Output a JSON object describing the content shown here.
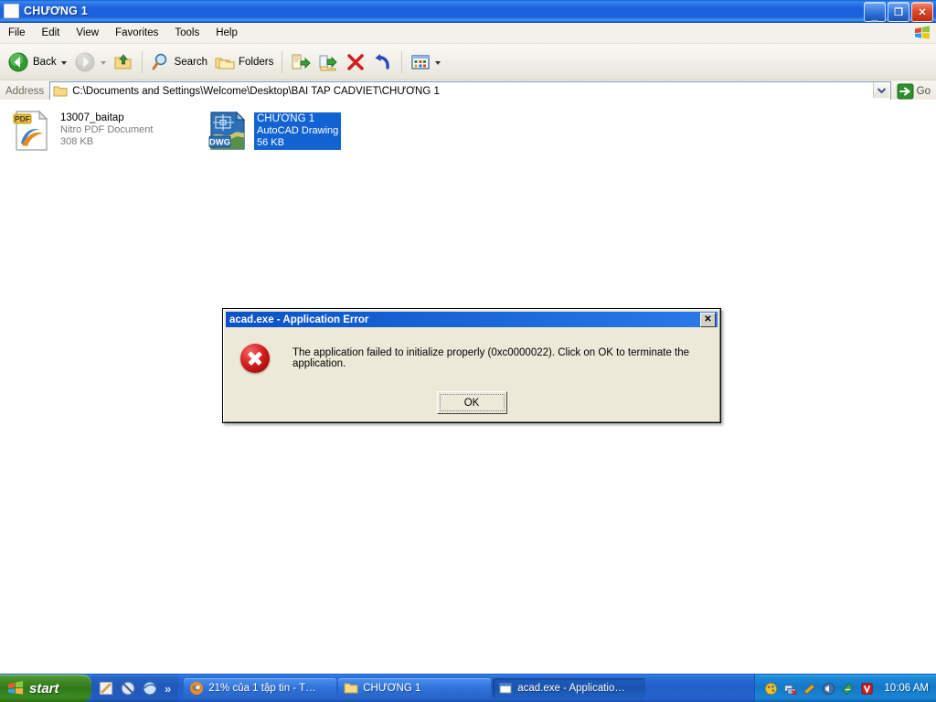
{
  "window": {
    "title": "CHƯƠNG 1",
    "icon": "folder-window-icon",
    "buttons": {
      "minimize": "_",
      "maximize": "❐",
      "close": "✕"
    }
  },
  "menu": {
    "items": [
      {
        "label": "File"
      },
      {
        "label": "Edit"
      },
      {
        "label": "View"
      },
      {
        "label": "Favorites"
      },
      {
        "label": "Tools"
      },
      {
        "label": "Help"
      }
    ],
    "logo": "windows-flag-logo"
  },
  "toolbar": {
    "back": "Back",
    "forward": "",
    "up": "",
    "search": "Search",
    "folders": "Folders",
    "move_to": "",
    "copy_to": "",
    "delete": "",
    "undo": "",
    "views": ""
  },
  "address": {
    "label": "Address",
    "path": "C:\\Documents and Settings\\Welcome\\Desktop\\BAI TAP CADVIET\\CHƯƠNG 1",
    "go_label": "Go"
  },
  "files": [
    {
      "name": "13007_baitap",
      "type": "Nitro PDF Document",
      "size": "308 KB",
      "icon": "pdf-file-icon",
      "badge": "PDF",
      "selected": false
    },
    {
      "name": "CHƯƠNG 1",
      "type": "AutoCAD Drawing",
      "size": "56 KB",
      "icon": "dwg-file-icon",
      "badge": "DWG",
      "selected": true
    }
  ],
  "dialog": {
    "title": "acad.exe - Application Error",
    "close_glyph": "✕",
    "icon": "error-circle-icon",
    "message": "The application failed to initialize properly (0xc0000022). Click on OK to terminate the application.",
    "ok_label": "OK"
  },
  "taskbar": {
    "start_label": "start",
    "quicklaunch_overflow": "»",
    "tasks": [
      {
        "label": "21% của 1 tập tin - T…",
        "icon": "firefox-icon",
        "active": false
      },
      {
        "label": "CHƯƠNG 1",
        "icon": "folder-icon",
        "active": false
      },
      {
        "label": "acad.exe - Applicatio…",
        "icon": "app-error-icon",
        "active": true
      }
    ],
    "clock": "10:06 AM"
  },
  "colors": {
    "titlebar_blue": "#1b62dd",
    "selection_blue": "#1263d2",
    "dialog_face": "#ece9d8",
    "error_red": "#d61f1f",
    "start_green": "#2f7a18",
    "taskbar_blue": "#245fc9"
  }
}
